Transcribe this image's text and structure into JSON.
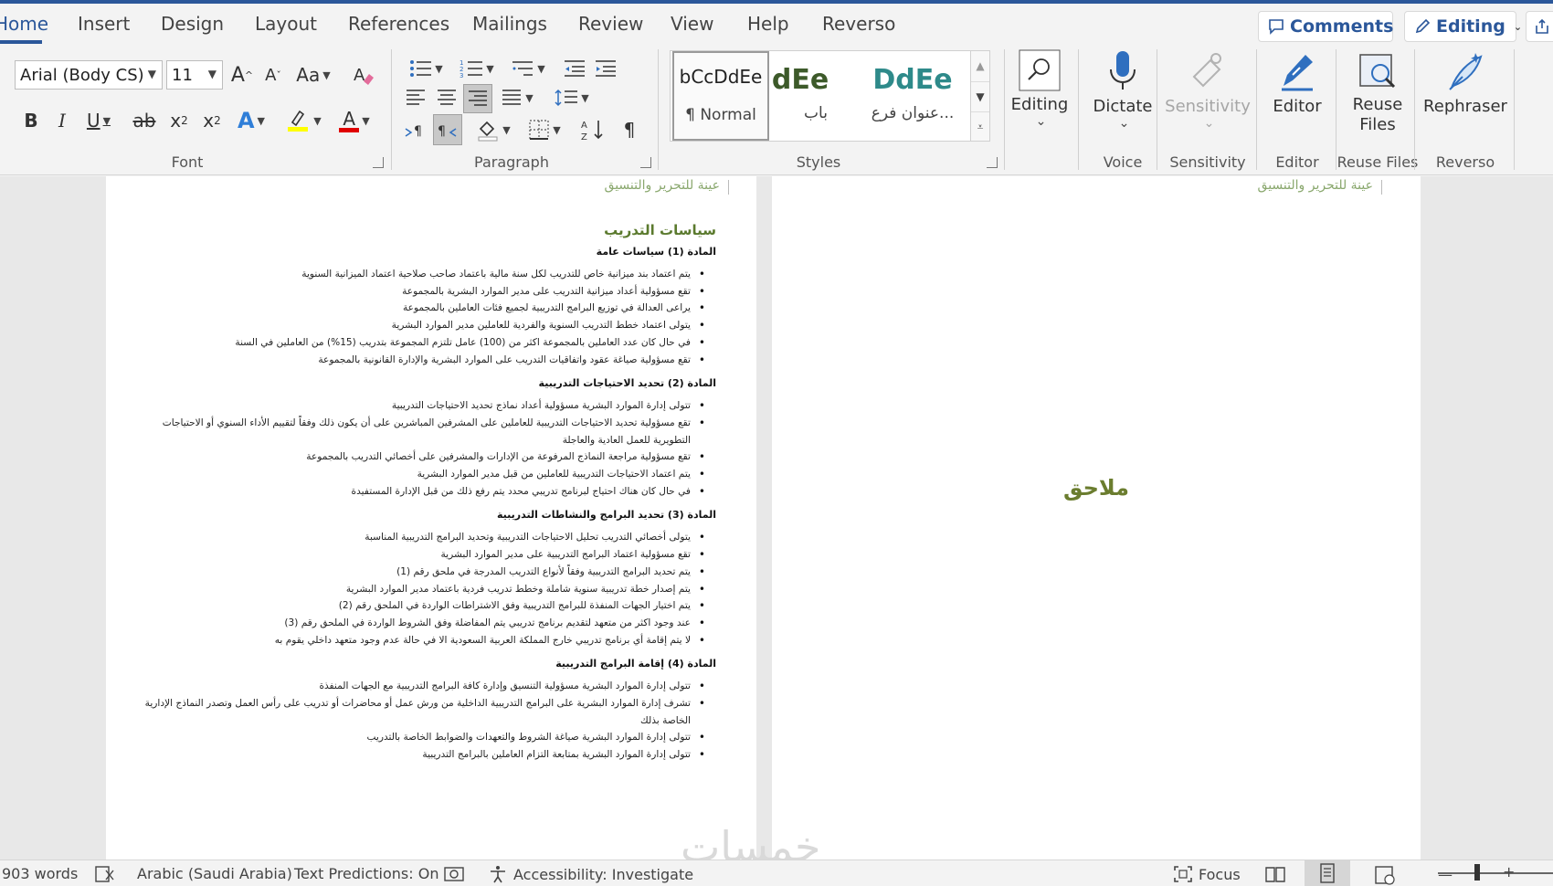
{
  "tabs": [
    "Home",
    "Insert",
    "Design",
    "Layout",
    "References",
    "Mailings",
    "Review",
    "View",
    "Help",
    "Reverso"
  ],
  "active_tab": "Home",
  "top_right": {
    "comments_label": "Comments",
    "editing_label": "Editing"
  },
  "font_group": {
    "label": "Font",
    "font_name": "Arial (Body CS)",
    "font_size": "11",
    "grow": "A",
    "shrink": "A",
    "change_case": "Aa",
    "bold": "B",
    "italic": "I",
    "underline": "U",
    "strike": "ab",
    "subscript": "x",
    "superscript": "x",
    "sub_mark": "2",
    "sup_mark": "2",
    "text_effects": "A",
    "font_color": "A",
    "highlight_color": "#ffff00",
    "font_color_value": "#e00000"
  },
  "paragraph_group": {
    "label": "Paragraph"
  },
  "styles_group": {
    "label": "Styles",
    "items": [
      {
        "sample": "bCcDdEe",
        "name": "¶ Normal"
      },
      {
        "sample": "DdEe",
        "name": "باب"
      },
      {
        "sample": "DdEe",
        "name": "عنوان فرع..."
      }
    ]
  },
  "editing_group": {
    "label": "Editing"
  },
  "voice_group": {
    "label": "Voice",
    "button": "Dictate"
  },
  "sensitivity_group": {
    "label": "Sensitivity",
    "button": "Sensitivity"
  },
  "editor_group": {
    "label": "Editor",
    "button": "Editor"
  },
  "reuse_group": {
    "label": "Reuse Files",
    "button_line1": "Reuse",
    "button_line2": "Files"
  },
  "reverso_group": {
    "label": "Reverso",
    "button": "Rephraser"
  },
  "document": {
    "header_text": "عينة للتحرير والتنسيق",
    "section_title": "سياسات التدريب",
    "articles": [
      {
        "title": "المادة (1) سياسات عامة",
        "items": [
          "يتم اعتماد بند ميزانية خاص للتدريب لكل سنة مالية باعتماد صاحب صلاحية اعتماد الميزانية السنوية",
          "تقع مسؤولية أعداد ميزانية التدريب على مدير الموارد البشرية بالمجموعة",
          "يراعى العدالة في توزيع البرامج التدريبية لجميع فئات العاملين بالمجموعة",
          "يتولى اعتماد خطط التدريب السنوية والفردية للعاملين مدير الموارد البشرية",
          "في حال كان عدد العاملين بالمجموعة اكثر من (100) عامل تلتزم المجموعة بتدريب (15%) من العاملين في السنة",
          "تقع مسؤولية صياغة عقود واتفاقيات التدريب على الموارد البشرية والإدارة القانونية بالمجموعة"
        ]
      },
      {
        "title": "المادة (2) تحديد الاحتياجات التدريبية",
        "items": [
          "تتولى إدارة الموارد البشرية مسؤولية أعداد نماذج تحديد الاحتياجات التدريبية",
          "تقع مسؤولية تحديد الاحتياجات التدريبية للعاملين على المشرفين المباشرين على أن يكون ذلك وفقاً لتقييم الأداء السنوي أو الاحتياجات التطويرية للعمل العادية والعاجلة",
          "تقع مسؤولية مراجعة النماذج المرفوعة من الإدارات والمشرفين على أخصائي التدريب بالمجموعة",
          "يتم اعتماد الاحتياجات التدريبية للعاملين من قبل مدير الموارد البشرية",
          "في حال كان هناك احتياج لبرنامج تدريبي محدد يتم رفع ذلك من قبل الإدارة المستفيدة"
        ]
      },
      {
        "title": "المادة (3) تحديد البرامج والنشاطات التدريبية",
        "items": [
          "يتولى أخصائي التدريب تحليل الاحتياجات التدريبية وتحديد البرامج التدريبية المناسبة",
          "تقع مسؤولية اعتماد البرامج التدريبية على مدير الموارد البشرية",
          "يتم تحديد البرامج التدريبية وفقاً لأنواع التدريب المدرجة في ملحق رقم (1)",
          "يتم إصدار خطة تدريبية سنوية شاملة وخطط تدريب فردية باعتماد مدير الموارد البشرية",
          "يتم اختيار الجهات المنفذة للبرامج التدريبية وفق الاشتراطات الواردة في الملحق رقم (2)",
          "عند وجود اكثر من متعهد لتقديم برنامج تدريبي يتم المفاضلة وفق الشروط الواردة في الملحق رقم (3)",
          "لا يتم إقامة أي برنامج تدريبي خارج المملكة العربية السعودية الا في حالة عدم وجود متعهد داخلي يقوم به"
        ]
      },
      {
        "title": "المادة (4) إقامة البرامج التدريبية",
        "items": [
          "تتولى إدارة الموارد البشرية مسؤولية التنسيق وإدارة كافة البرامج التدريبية مع الجهات المنفذة",
          "تشرف إدارة الموارد البشرية على البرامج التدريبية الداخلية من ورش عمل أو محاضرات أو تدريب على رأس العمل وتصدر النماذج الإدارية الخاصة بذلك",
          "تتولى إدارة الموارد البشرية صياغة الشروط والتعهدات والضوابط الخاصة بالتدريب",
          "تتولى إدارة الموارد البشرية بمتابعة التزام العاملين بالبرامج التدريبية"
        ]
      }
    ],
    "annex_title": "ملاحق"
  },
  "status": {
    "words": "903 words",
    "language": "Arabic (Saudi Arabia)",
    "text_predictions": "Text Predictions: On",
    "accessibility": "Accessibility: Investigate",
    "focus": "Focus"
  },
  "watermark": "خمسات"
}
